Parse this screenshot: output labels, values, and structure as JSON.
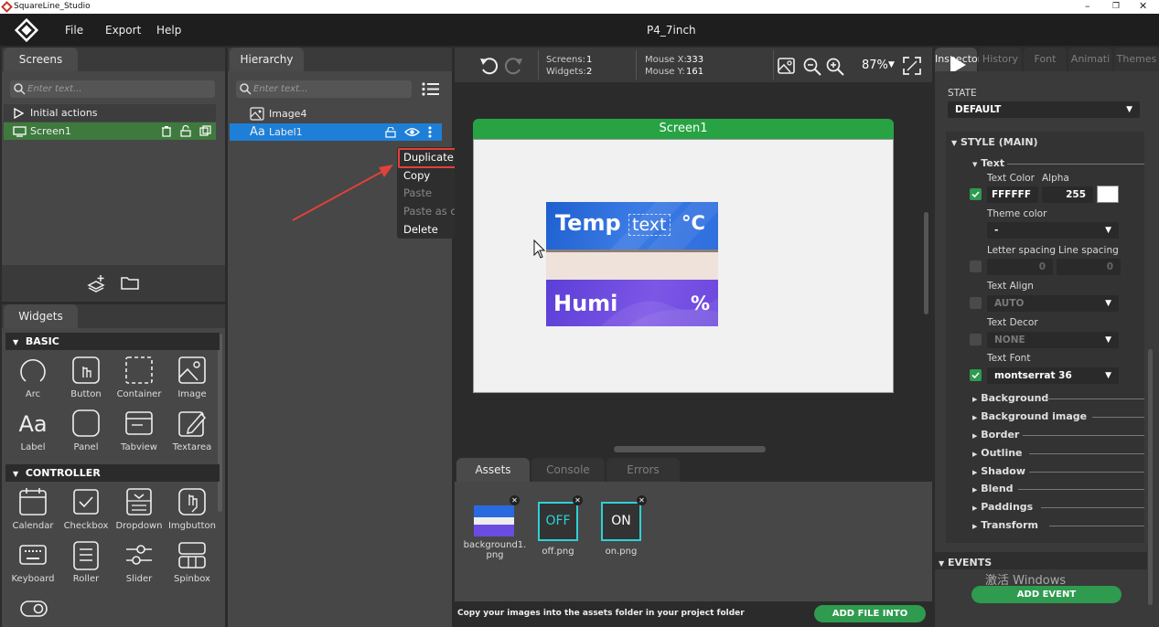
{
  "window": {
    "title": "SquareLine_Studio",
    "project": "P4_7inch"
  },
  "menu": [
    "File",
    "Export",
    "Help"
  ],
  "screens_panel": {
    "tab": "Screens",
    "search_placeholder": "Enter text...",
    "items": [
      "Initial actions",
      "Screen1"
    ]
  },
  "hierarchy_panel": {
    "tab": "Hierarchy",
    "search_placeholder": "Enter text...",
    "items": [
      "Image4",
      "Label1"
    ]
  },
  "context_menu": [
    "Duplicate",
    "Copy",
    "Paste",
    "Paste as child",
    "Delete"
  ],
  "widgets_panel": {
    "tab": "Widgets",
    "basic_title": "BASIC",
    "controller_title": "CONTROLLER",
    "basic": [
      "Arc",
      "Button",
      "Container",
      "Image",
      "Label",
      "Panel",
      "Tabview",
      "Textarea"
    ],
    "controller": [
      "Calendar",
      "Checkbox",
      "Dropdown",
      "Imgbutton",
      "Keyboard",
      "Roller",
      "Slider",
      "Spinbox"
    ]
  },
  "toolbar": {
    "screens_label": "Screens:",
    "screens_value": "1",
    "widgets_label": "Widgets:",
    "widgets_value": "2",
    "mouse_x_label": "Mouse X:",
    "mouse_x_value": "333",
    "mouse_y_label": "Mouse Y:",
    "mouse_y_value": "161",
    "zoom": "87%"
  },
  "canvas": {
    "screen_title": "Screen1",
    "temp_label": "Temp",
    "text_label": "text",
    "temp_unit": "°C",
    "humi_label": "Humi",
    "humi_unit": "%"
  },
  "bottom_panel": {
    "tabs": [
      "Assets",
      "Console",
      "Errors"
    ],
    "assets": [
      "background1.\npng",
      "off.png",
      "on.png"
    ],
    "off_text": "OFF",
    "on_text": "ON",
    "hint": "Copy your images into the assets folder in your project folder",
    "add_button": "ADD FILE INTO ASSETS"
  },
  "inspector": {
    "tabs": [
      "Inspector",
      "History",
      "Font",
      "Animati",
      "Themes"
    ],
    "state_label": "STATE",
    "state_value": "DEFAULT",
    "style_title": "STYLE (MAIN)",
    "text_title": "Text",
    "text_color_label": "Text Color",
    "alpha_label": "Alpha",
    "text_color_value": "FFFFFF",
    "alpha_value": "255",
    "theme_color_label": "Theme color",
    "theme_color_value": "-",
    "letter_spacing_label": "Letter spacing",
    "line_spacing_label": "Line spacing",
    "letter_spacing_value": "0",
    "line_spacing_value": "0",
    "text_align_label": "Text Align",
    "text_align_value": "AUTO",
    "text_decor_label": "Text Decor",
    "text_decor_value": "NONE",
    "text_font_label": "Text Font",
    "text_font_value": "montserrat 36",
    "properties": [
      "Background",
      "Background image",
      "Border",
      "Outline",
      "Shadow",
      "Blend",
      "Paddings",
      "Transform"
    ],
    "events_title": "EVENTS",
    "add_event": "ADD EVENT",
    "watermark": "激活 Windows"
  },
  "colors": {
    "accent_green": "#2e9b4f",
    "selection_blue": "#1e7fd8",
    "highlight_red": "#e0413a"
  }
}
